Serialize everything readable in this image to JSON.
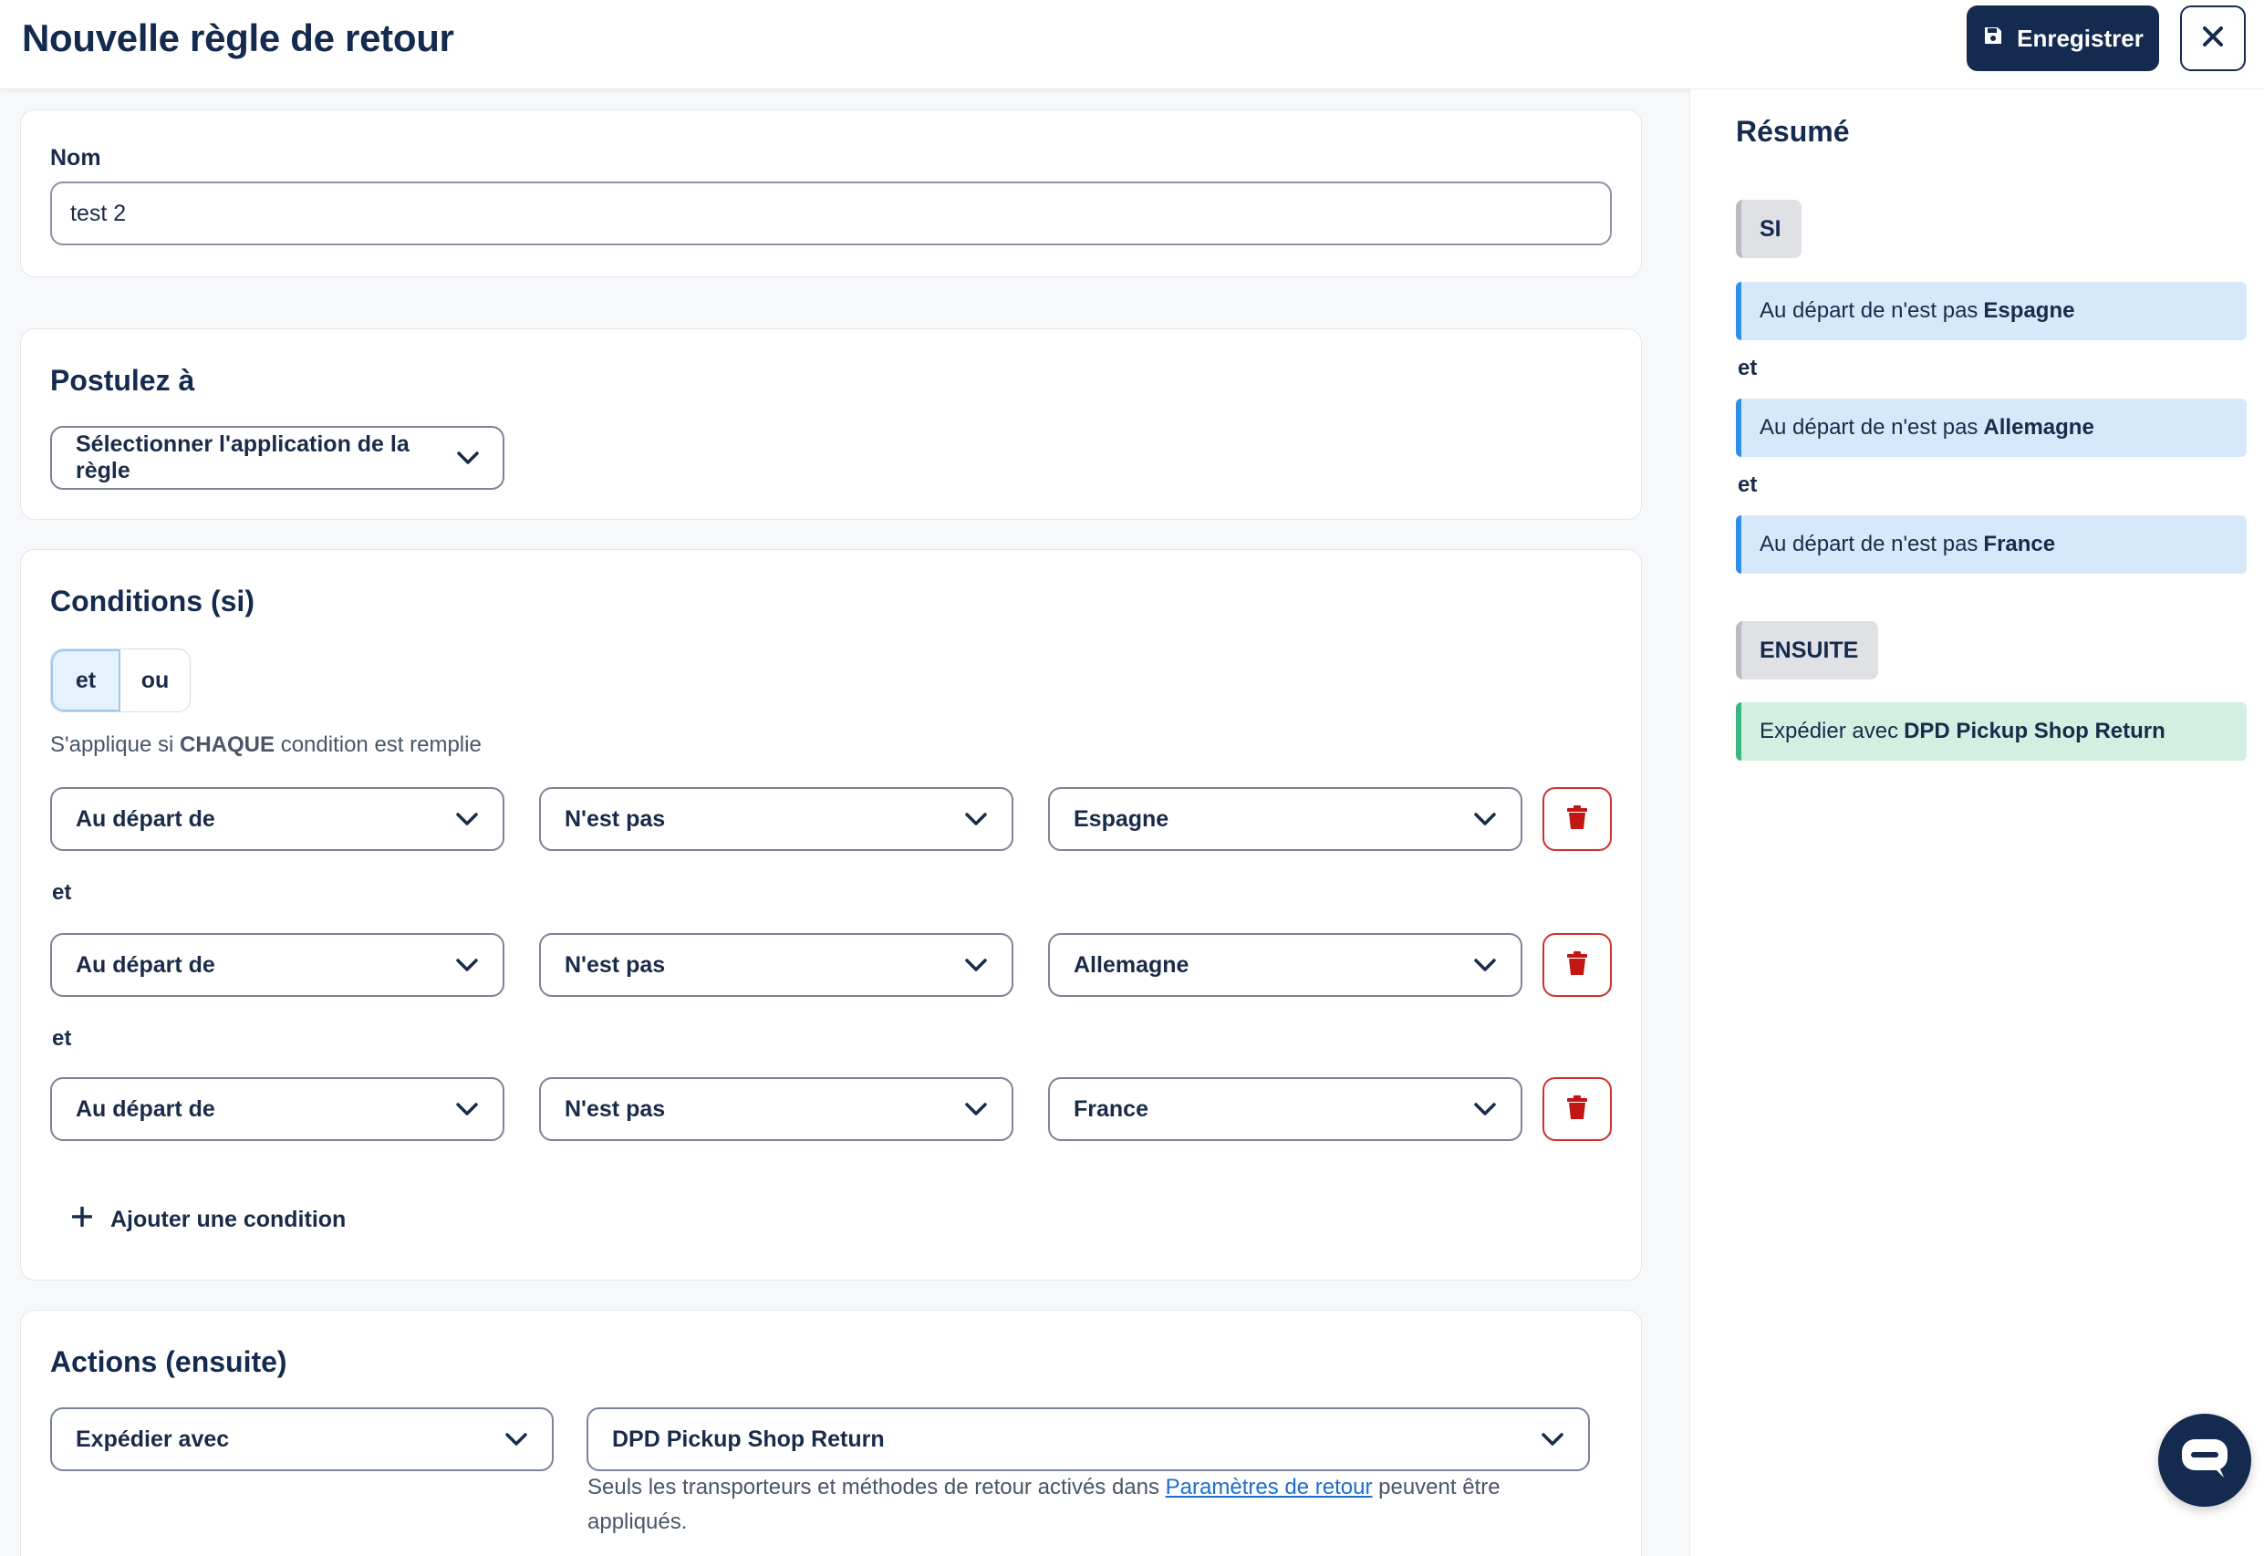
{
  "header": {
    "title": "Nouvelle règle de retour",
    "save_label": "Enregistrer"
  },
  "name_section": {
    "label": "Nom",
    "value": "test 2"
  },
  "apply_section": {
    "title": "Postulez à",
    "select_label": "Sélectionner l'application de la règle"
  },
  "conditions_section": {
    "title": "Conditions (si)",
    "toggle": [
      "et",
      "ou"
    ],
    "active_toggle": "et",
    "hint_prefix": "S'applique si",
    "hint_strong": "CHAQUE",
    "hint_suffix": "condition est remplie",
    "joiner": "et",
    "rows": [
      {
        "field": "Au départ de",
        "operator": "N'est pas",
        "value": "Espagne"
      },
      {
        "field": "Au départ de",
        "operator": "N'est pas",
        "value": "Allemagne"
      },
      {
        "field": "Au départ de",
        "operator": "N'est pas",
        "value": "France"
      }
    ],
    "add_label": "Ajouter une condition"
  },
  "actions_section": {
    "title": "Actions (ensuite)",
    "action": "Expédier avec",
    "carrier": "DPD Pickup Shop Return",
    "note_prefix": "Seuls les transporteurs et méthodes de retour activés dans",
    "note_link": "Paramètres de retour",
    "note_suffix": "peuvent être appliqués."
  },
  "summary": {
    "title": "Résumé",
    "if_tag": "SI",
    "then_tag": "ENSUITE",
    "joiner": "et",
    "conditions": [
      {
        "text": "Au départ de n'est pas",
        "value": "Espagne"
      },
      {
        "text": "Au départ de n'est pas",
        "value": "Allemagne"
      },
      {
        "text": "Au départ de n'est pas",
        "value": "France"
      }
    ],
    "action_text": "Expédier avec",
    "action_value": "DPD Pickup Shop Return"
  },
  "colors": {
    "primary": "#142a4e",
    "danger": "#d32f2f",
    "summary_condition": "#d6e9fb",
    "summary_action": "#d2efe2"
  },
  "icons": [
    "save-icon",
    "close-icon",
    "chevron-down-icon",
    "trash-icon",
    "plus-icon",
    "chat-icon"
  ]
}
